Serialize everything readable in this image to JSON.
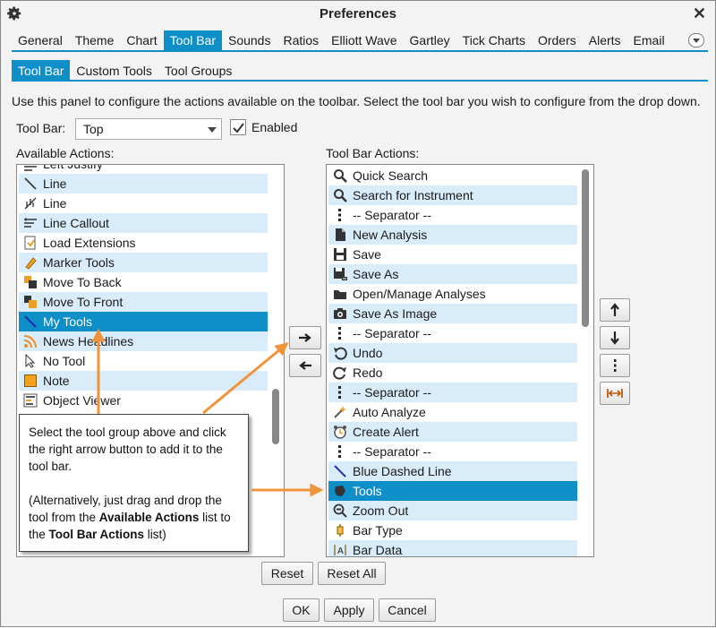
{
  "window": {
    "title": "Preferences"
  },
  "main_tabs": [
    "General",
    "Theme",
    "Chart",
    "Tool Bar",
    "Sounds",
    "Ratios",
    "Elliott Wave",
    "Gartley",
    "Tick Charts",
    "Orders",
    "Alerts",
    "Email"
  ],
  "main_tabs_active": "Tool Bar",
  "sub_tabs": [
    "Tool Bar",
    "Custom Tools",
    "Tool Groups"
  ],
  "sub_tabs_active": "Tool Bar",
  "description": "Use this panel to configure the actions available on the toolbar.  Select the tool bar you wish to configure from the drop down.",
  "toolbar_select": {
    "label": "Tool Bar:",
    "value": "Top"
  },
  "enabled": {
    "label": "Enabled",
    "checked": true
  },
  "available_actions": {
    "label": "Available Actions:",
    "items": [
      {
        "label": "Left Justify",
        "icon": "left-justify-icon"
      },
      {
        "label": "Line",
        "icon": "line-icon"
      },
      {
        "label": "Line",
        "icon": "line-ticks-icon"
      },
      {
        "label": "Line Callout",
        "icon": "line-callout-icon"
      },
      {
        "label": "Load Extensions",
        "icon": "load-extensions-icon"
      },
      {
        "label": "Marker Tools",
        "icon": "marker-icon"
      },
      {
        "label": "Move To Back",
        "icon": "move-to-back-icon"
      },
      {
        "label": "Move To Front",
        "icon": "move-to-front-icon"
      },
      {
        "label": "My Tools",
        "icon": "my-tools-icon"
      },
      {
        "label": "News Headlines",
        "icon": "rss-icon"
      },
      {
        "label": "No Tool",
        "icon": "arrow-cursor-icon"
      },
      {
        "label": "Note",
        "icon": "note-icon"
      },
      {
        "label": "Object Viewer",
        "icon": "object-viewer-icon"
      }
    ],
    "selected": "My Tools"
  },
  "toolbar_actions": {
    "label": "Tool Bar Actions:",
    "items": [
      {
        "label": "Quick Search",
        "icon": "search-icon"
      },
      {
        "label": "Search for Instrument",
        "icon": "search-icon"
      },
      {
        "label": "-- Separator --",
        "icon": "separator-icon"
      },
      {
        "label": "New Analysis",
        "icon": "new-document-icon"
      },
      {
        "label": "Save",
        "icon": "save-icon"
      },
      {
        "label": "Save As",
        "icon": "save-as-icon"
      },
      {
        "label": "Open/Manage Analyses",
        "icon": "folder-icon"
      },
      {
        "label": "Save As Image",
        "icon": "camera-icon"
      },
      {
        "label": "-- Separator --",
        "icon": "separator-icon"
      },
      {
        "label": "Undo",
        "icon": "undo-icon"
      },
      {
        "label": "Redo",
        "icon": "redo-icon"
      },
      {
        "label": "-- Separator --",
        "icon": "separator-icon"
      },
      {
        "label": "Auto Analyze",
        "icon": "magic-wand-icon"
      },
      {
        "label": "Create Alert",
        "icon": "alarm-clock-icon"
      },
      {
        "label": "-- Separator --",
        "icon": "separator-icon"
      },
      {
        "label": "Blue Dashed Line",
        "icon": "blue-line-icon"
      },
      {
        "label": "Tools",
        "icon": "tools-icon"
      },
      {
        "label": "Zoom Out",
        "icon": "zoom-out-icon"
      },
      {
        "label": "Bar Type",
        "icon": "bar-type-icon"
      },
      {
        "label": "Bar Data",
        "icon": "bar-data-icon"
      }
    ],
    "selected": "Tools"
  },
  "callout": {
    "line1": "Select the tool group above and click the right arrow button to add it to the tool bar.",
    "line2_pre": "(Alternatively, just drag and drop the tool from the ",
    "line2_b1": "Available Actions",
    "line2_mid": " list to the ",
    "line2_b2": "Tool Bar Actions",
    "line2_post": " list)"
  },
  "buttons": {
    "reset": "Reset",
    "reset_all": "Reset All",
    "ok": "OK",
    "apply": "Apply",
    "cancel": "Cancel"
  },
  "colors": {
    "accent": "#0e8fc7",
    "row_alt": "#d9ecfa",
    "arrow": "#f0943c"
  }
}
